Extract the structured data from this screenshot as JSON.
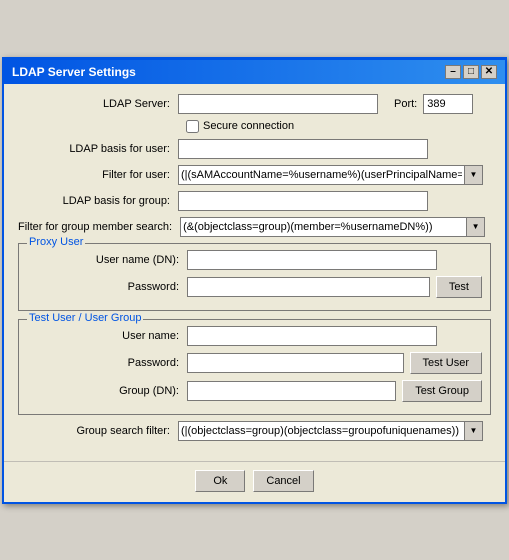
{
  "dialog": {
    "title": "LDAP Server Settings",
    "close_btn": "✕",
    "minimize_btn": "–",
    "maximize_btn": "□"
  },
  "form": {
    "ldap_server_label": "LDAP Server:",
    "ldap_server_value": "",
    "ldap_server_placeholder": "",
    "port_label": "Port:",
    "port_value": "389",
    "secure_connection_label": "Secure connection",
    "ldap_basis_user_label": "LDAP basis for user:",
    "ldap_basis_user_value": "",
    "filter_user_label": "Filter for user:",
    "filter_user_value": "(|(sAMAccountName=%username%)(userPrincipalName=%",
    "ldap_basis_group_label": "LDAP basis for group:",
    "ldap_basis_group_value": "",
    "filter_group_label": "Filter for group member search:",
    "filter_group_value": "(&(objectclass=group)(member=%usernameDN%))",
    "proxy_section_title": "Proxy User",
    "proxy_username_label": "User name (DN):",
    "proxy_username_value": "",
    "proxy_password_label": "Password:",
    "proxy_password_value": "",
    "test_btn_label": "Test",
    "test_section_title": "Test User / User Group",
    "test_username_label": "User name:",
    "test_username_value": "",
    "test_password_label": "Password:",
    "test_password_value": "",
    "test_user_btn_label": "Test User",
    "test_group_label": "Group (DN):",
    "test_group_value": "",
    "test_group_btn_label": "Test Group",
    "group_search_label": "Group search filter:",
    "group_search_value": "(|(objectclass=group)(objectclass=groupofuniquenames))",
    "ok_btn_label": "Ok",
    "cancel_btn_label": "Cancel"
  }
}
